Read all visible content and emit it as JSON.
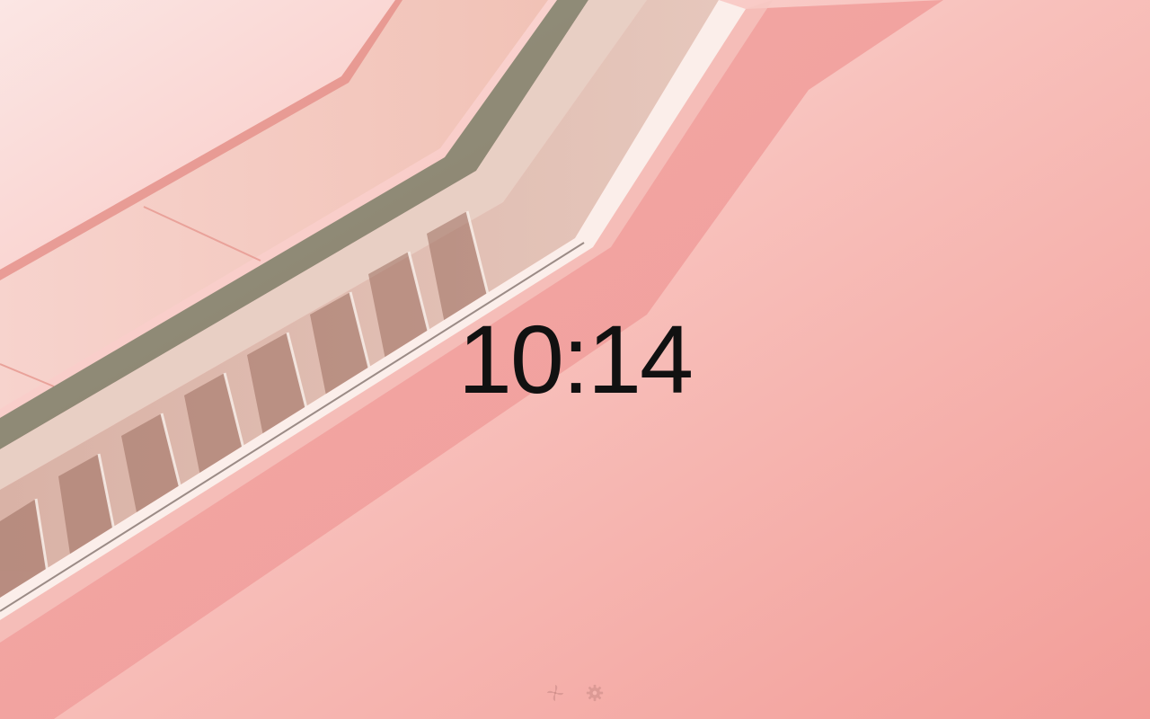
{
  "clock": {
    "time": "10:14"
  },
  "wallpaper": {
    "subject": "pink-staircase-photo",
    "colors": {
      "sky": "#f6b3ad",
      "sky_light": "#fbe4e2",
      "stair_wall": "#f2a3a1",
      "stair_face": "#dcb7ad",
      "stair_shadow": "#9a6a5c",
      "rail": "#5c6a52"
    }
  },
  "toolbar": {
    "icons": [
      {
        "name": "pinwheel-icon"
      },
      {
        "name": "gear-icon"
      }
    ],
    "icon_color": "#c98a86"
  }
}
